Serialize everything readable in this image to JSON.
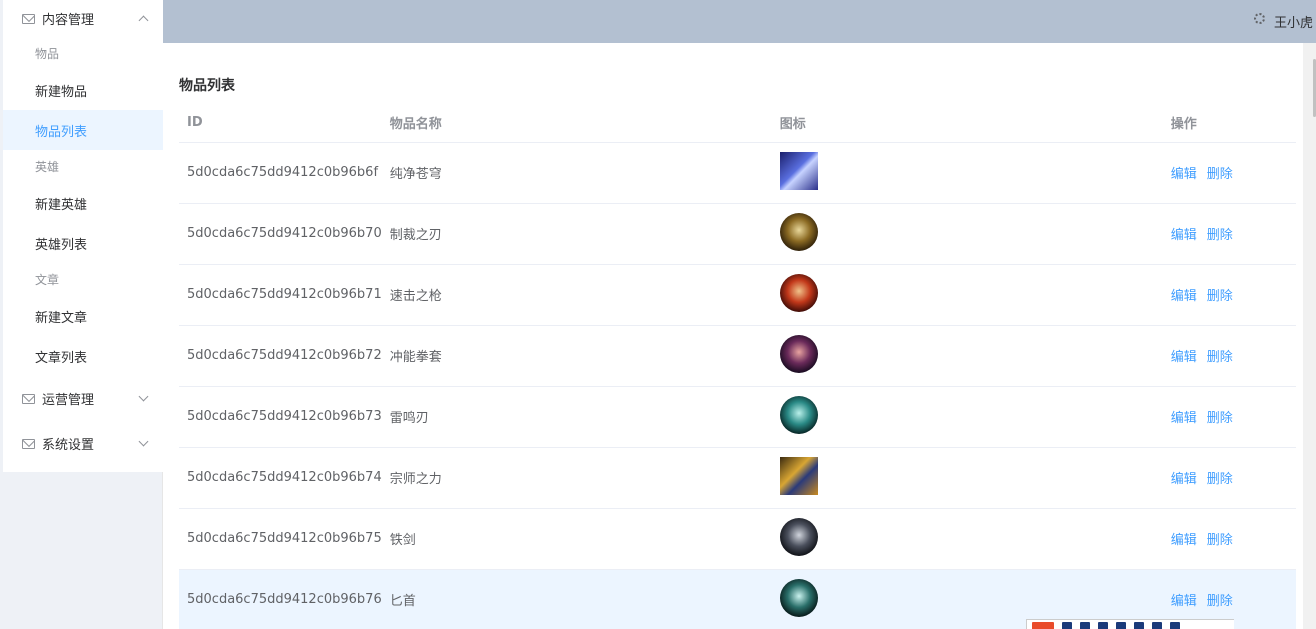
{
  "header": {
    "user_name": "王小虎"
  },
  "sidebar": {
    "content_menu": "内容管理",
    "groups": [
      {
        "title": "物品",
        "items": [
          "新建物品",
          "物品列表"
        ]
      },
      {
        "title": "英雄",
        "items": [
          "新建英雄",
          "英雄列表"
        ]
      },
      {
        "title": "文章",
        "items": [
          "新建文章",
          "文章列表"
        ]
      }
    ],
    "ops_menu": "运营管理",
    "settings_menu": "系统设置"
  },
  "main": {
    "title": "物品列表",
    "columns": {
      "id": "ID",
      "name": "物品名称",
      "icon": "图标",
      "ops": "操作"
    },
    "edit_label": "编辑",
    "delete_label": "删除",
    "rows": [
      {
        "id": "5d0cda6c75dd9412c0b96b6f",
        "name": "纯净苍穹"
      },
      {
        "id": "5d0cda6c75dd9412c0b96b70",
        "name": "制裁之刃"
      },
      {
        "id": "5d0cda6c75dd9412c0b96b71",
        "name": "速击之枪"
      },
      {
        "id": "5d0cda6c75dd9412c0b96b72",
        "name": "冲能拳套"
      },
      {
        "id": "5d0cda6c75dd9412c0b96b73",
        "name": "雷鸣刃"
      },
      {
        "id": "5d0cda6c75dd9412c0b96b74",
        "name": "宗师之力"
      },
      {
        "id": "5d0cda6c75dd9412c0b96b75",
        "name": "铁剑"
      },
      {
        "id": "5d0cda6c75dd9412c0b96b76",
        "name": "匕首"
      }
    ]
  },
  "colors": {
    "accent": "#409eff",
    "header_bg": "#b3c0d1",
    "active_bg": "#ecf5ff"
  }
}
